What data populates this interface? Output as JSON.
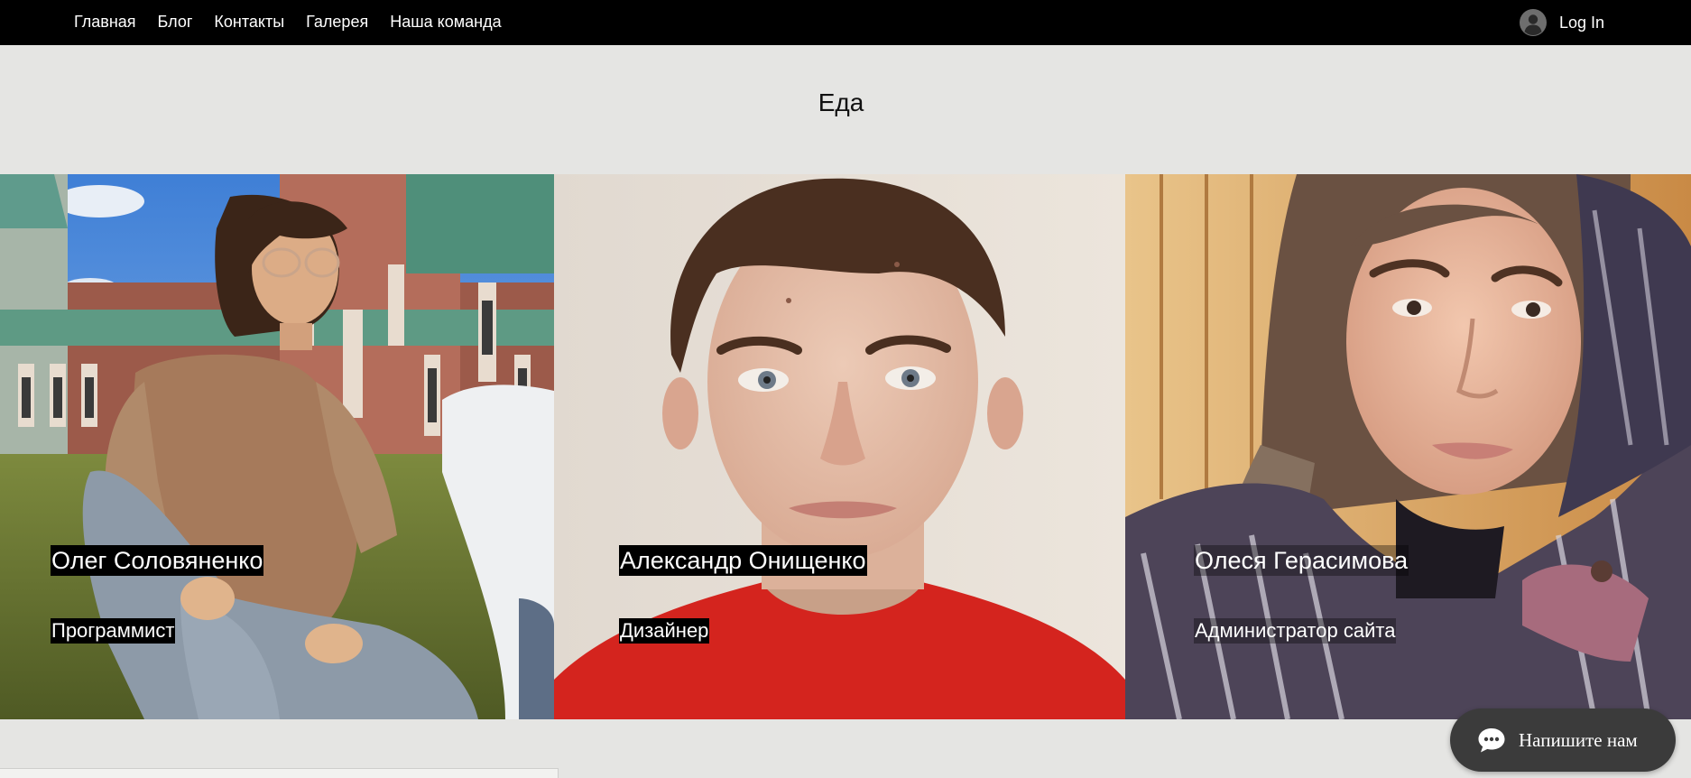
{
  "nav": {
    "items": [
      {
        "label": "Главная"
      },
      {
        "label": "Блог"
      },
      {
        "label": "Контакты"
      },
      {
        "label": "Галерея"
      },
      {
        "label": "Наша команда"
      }
    ],
    "login_label": "Log In",
    "login_icon": "user-avatar-icon"
  },
  "section": {
    "title": "Еда"
  },
  "team": [
    {
      "name": "Олег Соловяненко",
      "role": "Программист"
    },
    {
      "name": "Александр Онищенко",
      "role": "Дизайнер"
    },
    {
      "name": "Олеся Герасимова",
      "role": "Администратор сайта"
    }
  ],
  "chat": {
    "label": "Напишите нам",
    "icon": "chat-bubble-icon"
  },
  "colors": {
    "navbar": "#000000",
    "page_background": "#e5e5e3",
    "chat_button": "#3b3b3b",
    "label_background": "#000000"
  }
}
